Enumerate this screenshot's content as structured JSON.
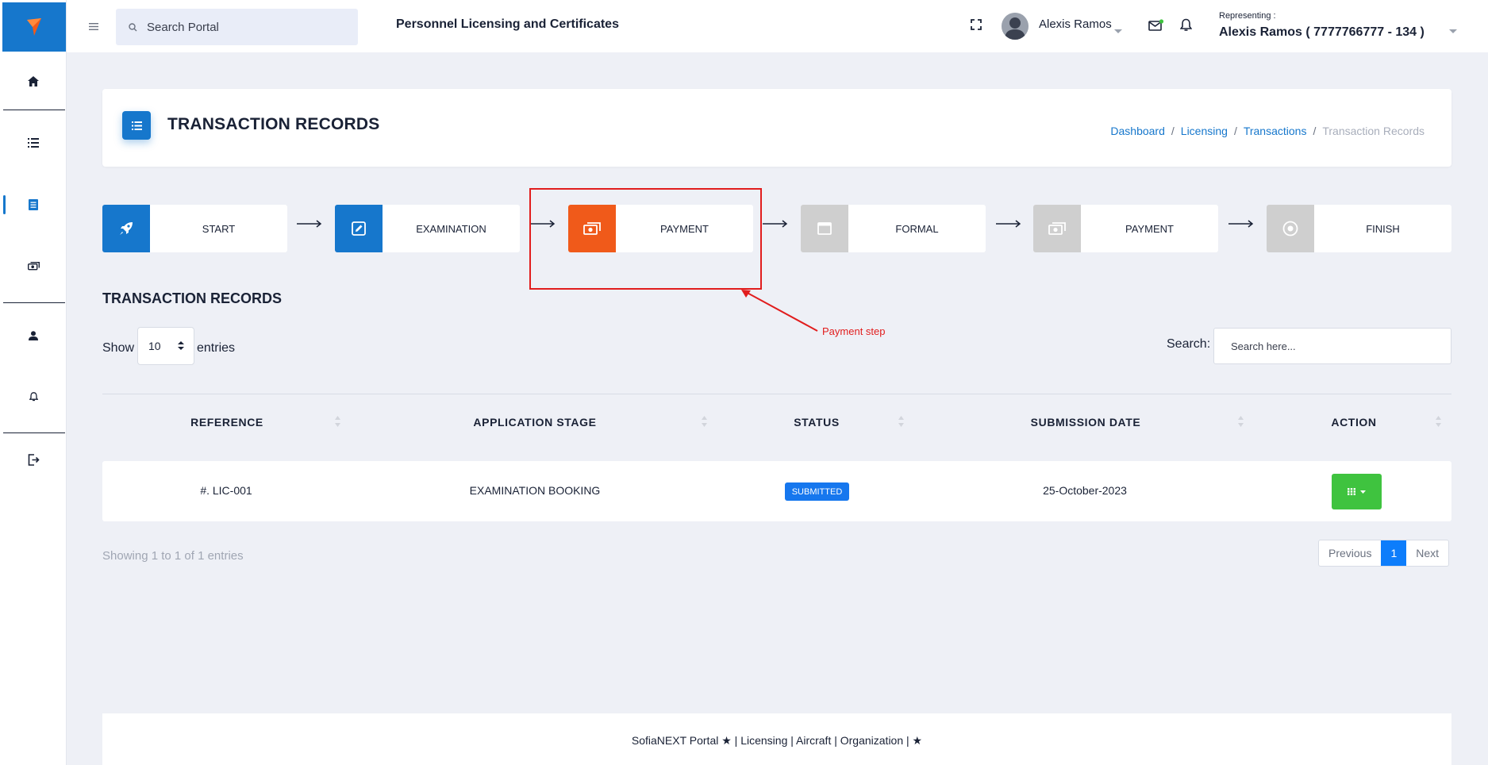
{
  "topbar": {
    "search_placeholder": "Search Portal",
    "app_title": "Personnel Licensing and Certificates",
    "user_name": "Alexis Ramos",
    "representing_label": "Representing :",
    "representing_value": "Alexis Ramos ( 7777766777 - 134 )"
  },
  "sidebar": {
    "items": [
      {
        "name": "home",
        "icon": "home-icon"
      },
      {
        "name": "list",
        "icon": "list-icon"
      },
      {
        "name": "document",
        "icon": "document-icon"
      },
      {
        "name": "payment",
        "icon": "money-icon"
      },
      {
        "name": "profile",
        "icon": "user-icon"
      },
      {
        "name": "notifications",
        "icon": "bell-icon"
      },
      {
        "name": "logout",
        "icon": "logout-icon"
      }
    ]
  },
  "header": {
    "title": "TRANSACTION RECORDS",
    "breadcrumb": [
      "Dashboard",
      "Licensing",
      "Transactions",
      "Transaction Records"
    ]
  },
  "steps": [
    {
      "label": "START",
      "state": "done",
      "icon": "rocket-icon"
    },
    {
      "label": "EXAMINATION",
      "state": "done",
      "icon": "edit-icon"
    },
    {
      "label": "PAYMENT",
      "state": "current",
      "icon": "money-icon"
    },
    {
      "label": "FORMAL",
      "state": "pending",
      "icon": "window-icon"
    },
    {
      "label": "PAYMENT",
      "state": "pending",
      "icon": "money-icon"
    },
    {
      "label": "FINISH",
      "state": "pending",
      "icon": "stop-circle-icon"
    }
  ],
  "annotation": "Payment step",
  "section_title": "TRANSACTION RECORDS",
  "table_controls": {
    "show": "Show",
    "entries_value": "10",
    "entries": "entries",
    "search_label": "Search:",
    "search_placeholder": "Search here..."
  },
  "table": {
    "columns": [
      "REFERENCE",
      "APPLICATION STAGE",
      "STATUS",
      "SUBMISSION DATE",
      "ACTION"
    ],
    "rows": [
      {
        "reference": "#. LIC-001",
        "stage": "EXAMINATION BOOKING",
        "status": "SUBMITTED",
        "date": "25-October-2023"
      }
    ]
  },
  "pagination": {
    "info": "Showing 1 to 1 of 1 entries",
    "previous": "Previous",
    "page": "1",
    "next": "Next"
  },
  "footer": "SofiaNEXT Portal ★ | Licensing | Aircraft | Organization | ★",
  "colors": {
    "primary": "#1677cc",
    "current_step": "#f05a1a",
    "pending_step": "#cfcfcf",
    "status_badge": "#1677ee",
    "action_button": "#3fc33f",
    "annotation": "#e11d1d"
  }
}
